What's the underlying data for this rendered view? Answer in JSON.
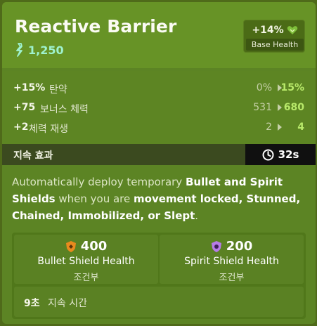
{
  "item": {
    "title": "Reactive Barrier",
    "price": "1,250",
    "base_bonus": "+14%",
    "base_label": "Base Health"
  },
  "stats": [
    {
      "value": "+15%",
      "label": "탄약",
      "from": "0%",
      "to": "15%"
    },
    {
      "value": "+75",
      "label": "보너스 체력",
      "from": "531",
      "to": "680"
    },
    {
      "value": "+2",
      "label": "체력 재생",
      "from": "2",
      "to": "4"
    }
  ],
  "duration": {
    "label": "지속 효과",
    "time": "32s"
  },
  "description": {
    "p1": "Automatically deploy temporary ",
    "b1": "Bullet and Spirit Shields",
    "p2": " when you are ",
    "b2": "movement locked, Stunned, Chained, Immobilized, or Slept",
    "p3": "."
  },
  "shields": [
    {
      "value": "400",
      "name": "Bullet Shield Health",
      "condition": "조건부",
      "icon": "bullet-shield-icon",
      "color": "#e88a1e"
    },
    {
      "value": "200",
      "name": "Spirit Shield Health",
      "condition": "조건부",
      "icon": "spirit-shield-icon",
      "color": "#b77be8"
    }
  ],
  "shield_duration": {
    "value": "9초",
    "label": "지속 시간"
  },
  "colors": {
    "accent_green": "#b8e96a",
    "price_teal": "#9ff2cf",
    "card": "#5c8424"
  }
}
